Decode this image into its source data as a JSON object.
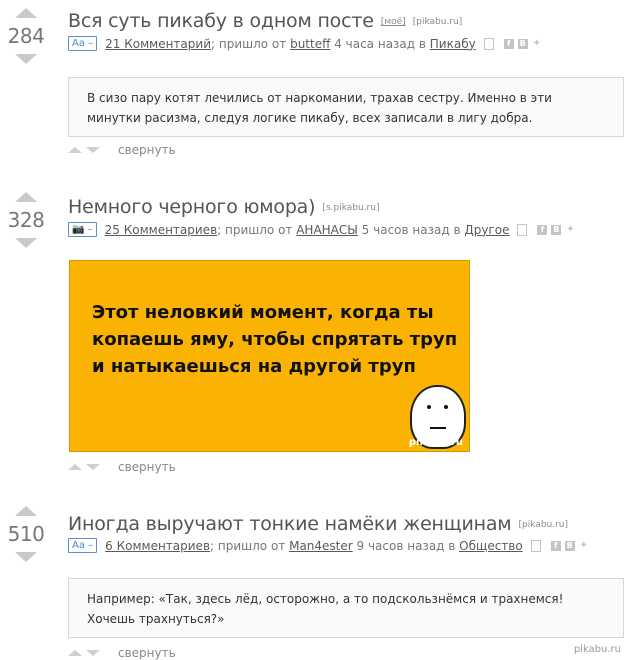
{
  "posts": [
    {
      "rating": "284",
      "title": "Вся суть пикабу в одном посте",
      "tags": [
        "[моё]",
        "[pikabu.ru]"
      ],
      "badge": "Aa –",
      "comments": "21 Комментарий",
      "meta_prefix": "; пришло от ",
      "author": "butteff",
      "time": " 4 часа назад в ",
      "category": "Пикабу",
      "body": "В сизо пару котят лечились от наркомании, трахав сестру. Именно в эти минутки расизма, следуя логике пикабу, всех записали в лигу добра.",
      "collapse": "свернуть"
    },
    {
      "rating": "328",
      "title": "Немного черного юмора)",
      "tags": [
        "[s.pikabu.ru]"
      ],
      "badge": "📷 –",
      "comments": "25 Комментариев",
      "meta_prefix": "; пришло от ",
      "author": "АНАНАСЫ",
      "time": " 5 часов назад в ",
      "category": "Другое",
      "image_text": "Этот неловкий момент, когда ты копаешь яму, чтобы спрятать труп и натыкаешься на другой труп",
      "image_watermark": "pikabu.ru",
      "collapse": "свернуть"
    },
    {
      "rating": "510",
      "title": "Иногда выручают тонкие намёки женщинам",
      "tags": [
        "[pikabu.ru]"
      ],
      "badge": "Aa –",
      "comments": "6 Комментариев",
      "meta_prefix": "; пришло от ",
      "author": "Man4ester",
      "time": " 9 часов назад в ",
      "category": "Общество",
      "body": "Например: «Так, здесь лёд, осторожно, а то подскользнёмся и трахнемся! Хочешь трахнуться?»",
      "collapse": "свернуть"
    }
  ],
  "page_watermark": "pikabu.ru",
  "share_icons": [
    "bookmark-icon",
    "facebook-icon",
    "vkontakte-icon",
    "twitter-icon"
  ]
}
